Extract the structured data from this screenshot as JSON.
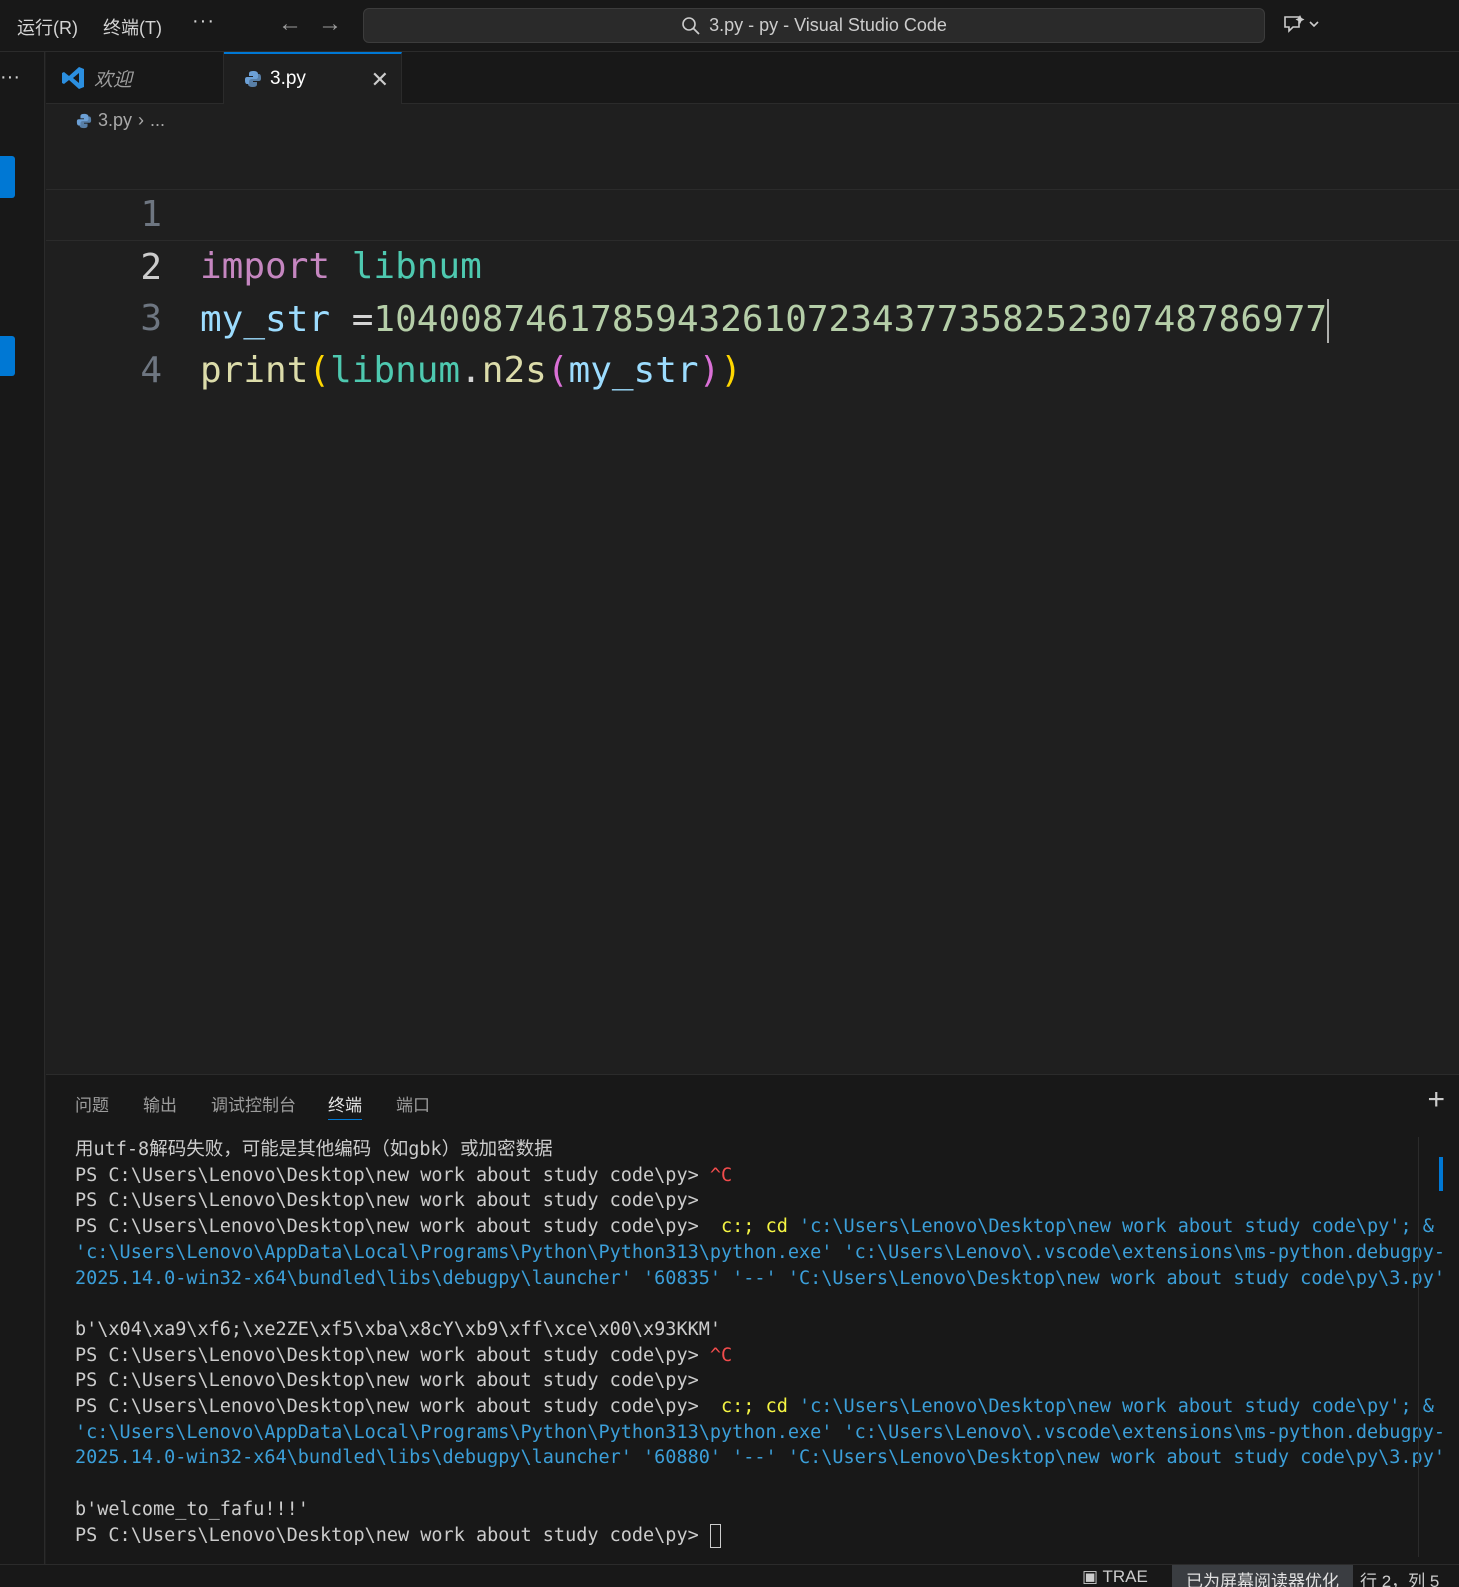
{
  "menu": {
    "run": "运行(R)",
    "terminal": "终端(T)",
    "more": "···"
  },
  "nav": {
    "back": "←",
    "forward": "→"
  },
  "search": {
    "text": "3.py - py - Visual Studio Code"
  },
  "activity": {
    "more": "···"
  },
  "tabs": [
    {
      "label": "欢迎",
      "icon": "vscode-logo-icon"
    },
    {
      "label": "3.py",
      "icon": "python-icon",
      "close": "✕"
    }
  ],
  "breadcrumb": {
    "file": "3.py",
    "sep": "›",
    "more": "..."
  },
  "editor": {
    "lines": [
      {
        "number": "1",
        "kw": "import",
        "module": "libnum"
      },
      {
        "number": "2",
        "var": "my_str",
        "op": " =",
        "num": "10400874617859432610723437735825230748786977"
      },
      {
        "number": "3",
        "fn": "print",
        "p1": "(",
        "mod": "libnum",
        "dot": ".",
        "fn2": "n2s",
        "p2": "(",
        "arg": "my_str",
        "p3": ")",
        "p4": ")"
      },
      {
        "number": "4"
      }
    ]
  },
  "panel": {
    "tabs": [
      "问题",
      "输出",
      "调试控制台",
      "终端",
      "端口"
    ],
    "plus": "+"
  },
  "terminal": {
    "prompt": "PS C:\\Users\\Lenovo\\Desktop\\new work about study code\\py>",
    "line0": "用utf-8解码失败，可能是其他编码（如gbk）或加密数据",
    "ctrl_c": "^C",
    "cmd_c": "c:;",
    "cmd_cd": "cd",
    "cmd_path": "'c:\\Users\\Lenovo\\Desktop\\new work about study code\\py'; &",
    "cmd_line2": "'c:\\Users\\Lenovo\\AppData\\Local\\Programs\\Python\\Python313\\python.exe' 'c:\\Users\\Lenovo\\.vscode\\extensions\\ms-python.debugpy-",
    "cmd_line3a": "2025.14.0-win32-x64\\bundled\\libs\\debugpy\\launcher' '60835' '--' 'C:\\Users\\Lenovo\\Desktop\\new work about study code\\py\\3.py'",
    "out1": "b'\\x04\\xa9\\xf6;\\xe2ZE\\xf5\\xba\\x8cY\\xb9\\xff\\xce\\x00\\x93KKM'",
    "cmd_line3b": "2025.14.0-win32-x64\\bundled\\libs\\debugpy\\launcher' '60880' '--' 'C:\\Users\\Lenovo\\Desktop\\new work about study code\\py\\3.py'",
    "out2": "b'welcome_to_fafu!!!'"
  },
  "status": {
    "trae": "TRAE",
    "screen_reader": "已为屏幕阅读器优化",
    "row": "行 2，",
    "col": "列 5"
  },
  "colors": {
    "accent": "#0078d4",
    "keyword": "#c586c0",
    "module": "#4ec9b0",
    "number": "#b5cea8",
    "function": "#dcdcaa",
    "variable": "#9cdcfe"
  }
}
